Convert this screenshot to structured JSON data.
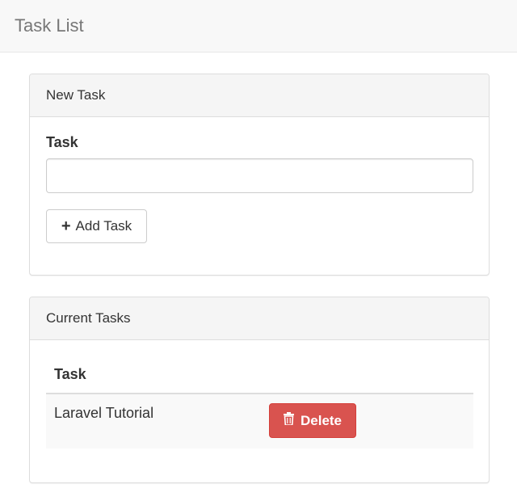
{
  "navbar": {
    "brand": "Task List"
  },
  "new_task_panel": {
    "heading": "New Task",
    "field_label": "Task",
    "input_value": "",
    "add_button_label": "Add Task",
    "add_button_icon": "plus-icon"
  },
  "current_tasks_panel": {
    "heading": "Current Tasks",
    "column_header": "Task",
    "rows": [
      {
        "name": "Laravel Tutorial",
        "delete_label": "Delete",
        "delete_icon": "trash-icon"
      }
    ]
  },
  "colors": {
    "danger": "#d9534f",
    "navbar_bg": "#f8f8f8",
    "panel_heading_bg": "#f5f5f5"
  }
}
